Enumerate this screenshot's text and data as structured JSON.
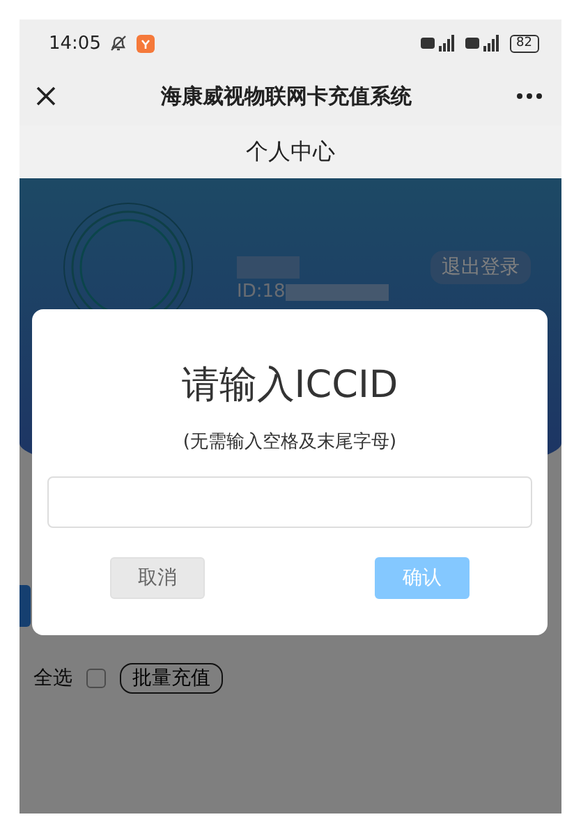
{
  "status_bar": {
    "time": "14:05",
    "battery": "82"
  },
  "title_bar": {
    "title": "海康威视物联网卡充值系统"
  },
  "page_header": {
    "title": "个人中心"
  },
  "profile": {
    "id_label": "ID:18",
    "logout": "退出登录"
  },
  "select_row": {
    "select_all": "全选",
    "checked": false,
    "batch_button": "批量充值"
  },
  "dialog": {
    "title": "请输入ICCID",
    "hint": "(无需输入空格及末尾字母)",
    "buttons": [
      {
        "label": "取消",
        "kind": "cancel"
      },
      {
        "label": "确认",
        "kind": "confirm"
      }
    ]
  }
}
